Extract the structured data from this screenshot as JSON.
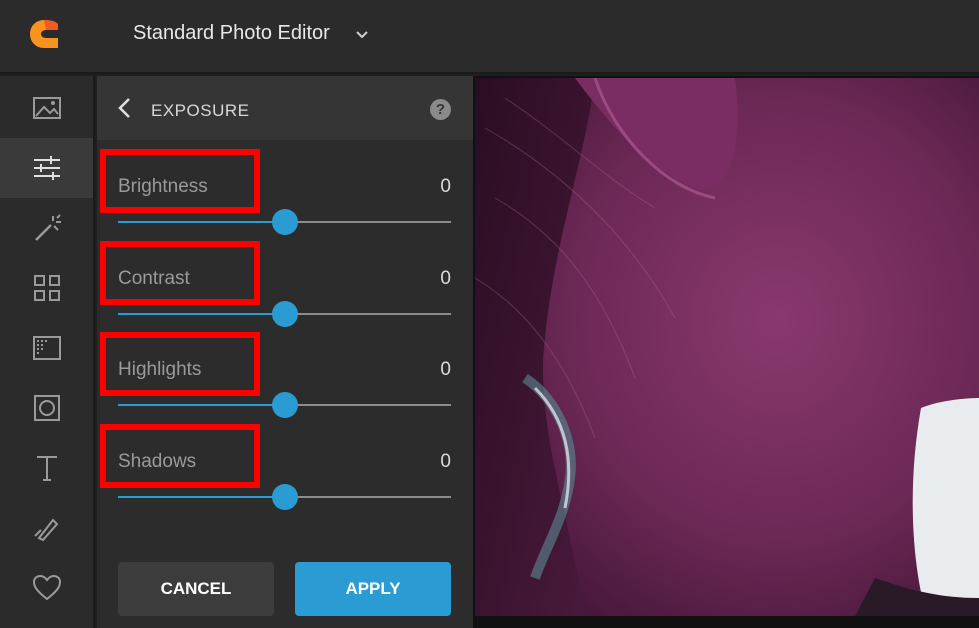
{
  "header": {
    "app_title": "Standard Photo Editor",
    "logo_icon": "app-logo-icon",
    "dropdown_icon": "chevron-down-icon"
  },
  "toolbar": {
    "tools": [
      {
        "name": "image-icon",
        "active": false
      },
      {
        "name": "adjust-sliders-icon",
        "active": true
      },
      {
        "name": "magic-wand-icon",
        "active": false
      },
      {
        "name": "grid-icon",
        "active": false
      },
      {
        "name": "texture-icon",
        "active": false
      },
      {
        "name": "frame-icon",
        "active": false
      },
      {
        "name": "text-icon",
        "active": false
      },
      {
        "name": "brush-icon",
        "active": false
      },
      {
        "name": "heart-icon",
        "active": false
      }
    ]
  },
  "panel": {
    "title": "EXPOSURE",
    "help_label": "?",
    "sliders": [
      {
        "label": "Brightness",
        "value": "0",
        "level": 0.5
      },
      {
        "label": "Contrast",
        "value": "0",
        "level": 0.5
      },
      {
        "label": "Highlights",
        "value": "0",
        "level": 0.5
      },
      {
        "label": "Shadows",
        "value": "0",
        "level": 0.5
      }
    ],
    "cancel_label": "CANCEL",
    "apply_label": "APPLY"
  },
  "colors": {
    "accent": "#2a9bd3",
    "highlight_box": "#ff0000",
    "logo_orange": "#f7931e",
    "photo_tint": "#6b2855"
  }
}
